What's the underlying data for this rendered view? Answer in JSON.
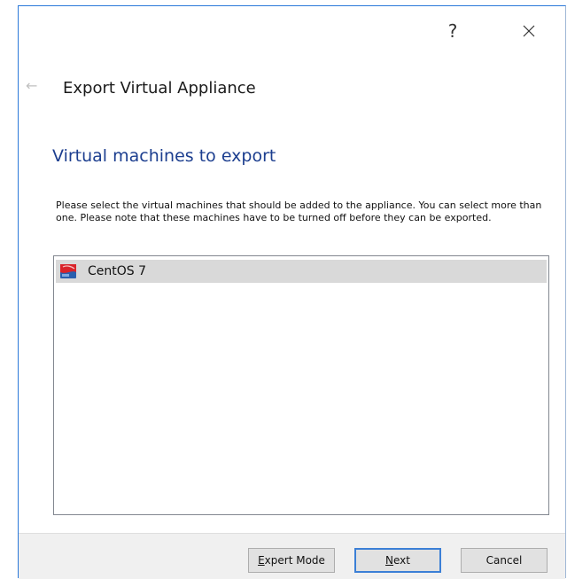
{
  "titlebar": {
    "help_label": "?"
  },
  "wizard": {
    "title": "Export Virtual Appliance",
    "page_heading": "Virtual machines to export",
    "description": "Please select the virtual machines that should be added to the appliance. You can select more than one. Please note that these machines have to be turned off before they can be exported."
  },
  "vm_list": {
    "items": [
      {
        "name": "CentOS 7",
        "icon": "centos-vm-icon",
        "selected": true
      }
    ]
  },
  "footer": {
    "expert_mode": {
      "mnemonic": "E",
      "rest": "xpert Mode"
    },
    "next": {
      "mnemonic": "N",
      "rest": "ext"
    },
    "cancel_label": "Cancel"
  },
  "colors": {
    "heading": "#1c3e8f",
    "selection": "#d9d9d9",
    "primary_border": "#3b7fd6",
    "footer_bg": "#f0f0f0"
  }
}
